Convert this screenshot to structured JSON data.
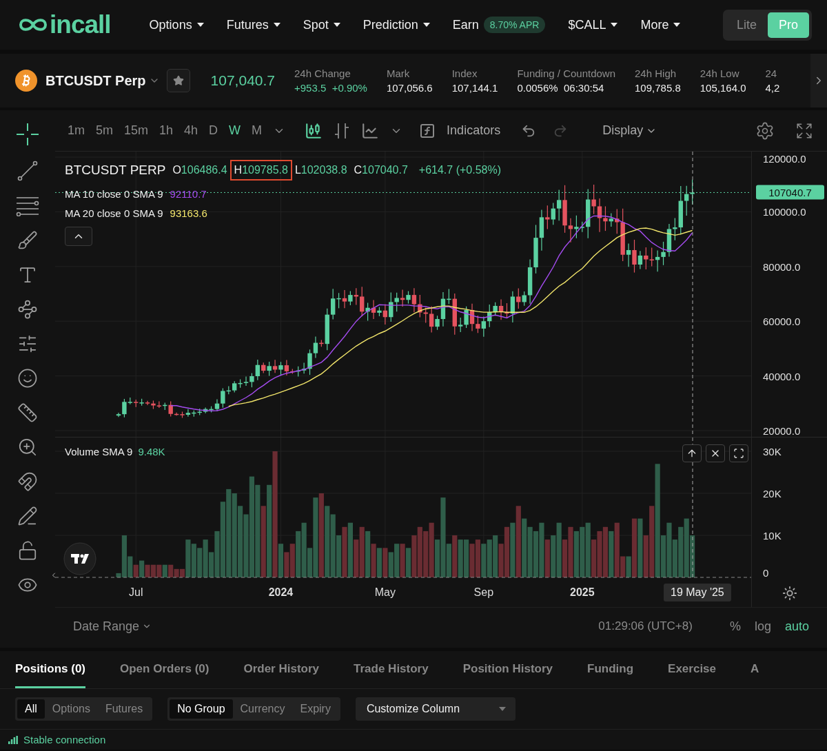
{
  "nav": {
    "logo_text": "incall",
    "menu": [
      {
        "label": "Options",
        "dropdown": true
      },
      {
        "label": "Futures",
        "dropdown": true
      },
      {
        "label": "Spot",
        "dropdown": true
      },
      {
        "label": "Prediction",
        "dropdown": true
      },
      {
        "label": "Earn",
        "badge": "8.70% APR",
        "dropdown": false
      },
      {
        "label": "$CALL",
        "dropdown": true
      },
      {
        "label": "More",
        "dropdown": true
      }
    ],
    "modes": [
      {
        "label": "Lite",
        "selected": false
      },
      {
        "label": "Pro",
        "selected": true
      }
    ]
  },
  "ticker": {
    "symbol": "BTCUSDT Perp",
    "last_price": "107,040.7",
    "stats": [
      {
        "label": "24h Change",
        "value": "+953.5  +0.90%",
        "positive": true
      },
      {
        "label": "Mark",
        "value": "107,056.6",
        "positive": false
      },
      {
        "label": "Index",
        "value": "107,144.1",
        "positive": false
      },
      {
        "label": "Funding / Countdown",
        "value": "0.0056%  06:30:54",
        "positive": false
      },
      {
        "label": "24h High",
        "value": "109,785.8",
        "positive": false
      },
      {
        "label": "24h Low",
        "value": "105,164.0",
        "positive": false
      },
      {
        "label": "24",
        "value": "4,2",
        "positive": false
      }
    ]
  },
  "chart": {
    "timeframes": [
      {
        "label": "1m",
        "selected": false
      },
      {
        "label": "5m",
        "selected": false
      },
      {
        "label": "15m",
        "selected": false
      },
      {
        "label": "1h",
        "selected": false
      },
      {
        "label": "4h",
        "selected": false
      },
      {
        "label": "D",
        "selected": false
      },
      {
        "label": "W",
        "selected": true
      },
      {
        "label": "M",
        "selected": false
      }
    ],
    "indicators_label": "Indicators",
    "display_label": "Display",
    "legend": {
      "symbol": "BTCUSDT PERP",
      "ohlc": [
        {
          "key": "O",
          "value": "106486.4",
          "highlighted": false
        },
        {
          "key": "H",
          "value": "109785.8",
          "highlighted": true
        },
        {
          "key": "L",
          "value": "102038.8",
          "highlighted": false
        },
        {
          "key": "C",
          "value": "107040.7",
          "highlighted": false
        }
      ],
      "change": "+614.7 (+0.58%)"
    },
    "moving_averages": [
      {
        "label": "MA 10 close 0 SMA 9",
        "value": "92110.7",
        "color": "#a44cf0"
      },
      {
        "label": "MA 20 close 0 SMA 9",
        "value": "93163.6",
        "color": "#f2e56b"
      }
    ],
    "price_axis": [
      "120000.0",
      "100000.0",
      "80000.0",
      "60000.0",
      "40000.0",
      "20000.0"
    ],
    "last_price_tag": "107040.7",
    "volume": {
      "label": "Volume SMA 9",
      "value": "9.48K",
      "axis": [
        "30K",
        "20K",
        "10K",
        "0"
      ]
    },
    "time_axis": [
      {
        "label": "Jul",
        "kind": "month"
      },
      {
        "label": "2024",
        "kind": "year"
      },
      {
        "label": "May",
        "kind": "month"
      },
      {
        "label": "Sep",
        "kind": "month"
      },
      {
        "label": "2025",
        "kind": "year"
      }
    ],
    "crosshair_date": "19 May '25",
    "footer": {
      "date_range": "Date Range",
      "clock": "01:29:06 (UTC+8)",
      "scale_options": [
        {
          "label": "%",
          "selected": false
        },
        {
          "label": "log",
          "selected": false
        },
        {
          "label": "auto",
          "selected": true
        }
      ]
    }
  },
  "bottom_tabs": [
    {
      "label": "Positions (0)",
      "selected": true
    },
    {
      "label": "Open Orders (0)",
      "selected": false
    },
    {
      "label": "Order History",
      "selected": false
    },
    {
      "label": "Trade History",
      "selected": false
    },
    {
      "label": "Position History",
      "selected": false
    },
    {
      "label": "Funding",
      "selected": false
    },
    {
      "label": "Exercise",
      "selected": false
    },
    {
      "label": "A",
      "selected": false
    }
  ],
  "filters": [
    [
      {
        "label": "All",
        "selected": true
      },
      {
        "label": "Options",
        "selected": false
      },
      {
        "label": "Futures",
        "selected": false
      }
    ],
    [
      {
        "label": "No Group",
        "selected": true
      },
      {
        "label": "Currency",
        "selected": false
      },
      {
        "label": "Expiry",
        "selected": false
      }
    ]
  ],
  "customize_column": "Customize Column",
  "status": "Stable connection"
}
